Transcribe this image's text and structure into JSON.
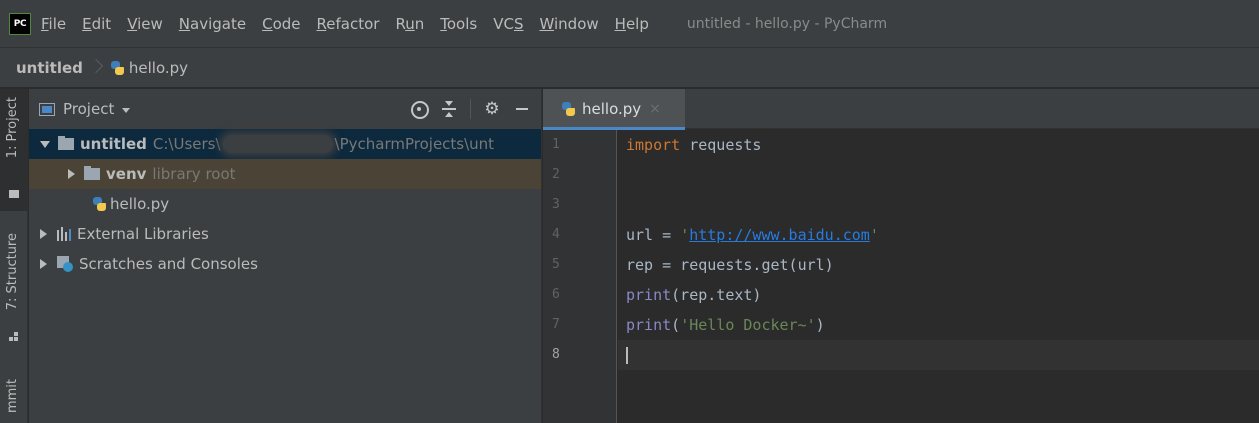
{
  "app": {
    "logo_text": "PC",
    "window_title": "untitled - hello.py - PyCharm"
  },
  "menu": [
    {
      "pre": "",
      "key": "F",
      "post": "ile"
    },
    {
      "pre": "",
      "key": "E",
      "post": "dit"
    },
    {
      "pre": "",
      "key": "V",
      "post": "iew"
    },
    {
      "pre": "",
      "key": "N",
      "post": "avigate"
    },
    {
      "pre": "",
      "key": "C",
      "post": "ode"
    },
    {
      "pre": "",
      "key": "R",
      "post": "efactor"
    },
    {
      "pre": "R",
      "key": "u",
      "post": "n"
    },
    {
      "pre": "",
      "key": "T",
      "post": "ools"
    },
    {
      "pre": "VC",
      "key": "S",
      "post": ""
    },
    {
      "pre": "",
      "key": "W",
      "post": "indow"
    },
    {
      "pre": "",
      "key": "H",
      "post": "elp"
    }
  ],
  "breadcrumb": {
    "project": "untitled",
    "file": "hello.py"
  },
  "left_stripe": {
    "project_tab": "1: Project",
    "structure_tab": "7: Structure",
    "commit_tab": "mmit"
  },
  "project_panel": {
    "title": "Project",
    "tree": {
      "root_label": "untitled",
      "root_path_start": "C:\\Users\\",
      "root_path_end": "\\PycharmProjects\\unt",
      "venv_label": "venv",
      "venv_hint": "library root",
      "file_label": "hello.py",
      "ext_libs_label": "External Libraries",
      "scratches_label": "Scratches and Consoles"
    }
  },
  "editor": {
    "tab_label": "hello.py",
    "tab_close": "×",
    "line_numbers": [
      "1",
      "2",
      "3",
      "4",
      "5",
      "6",
      "7",
      "8"
    ],
    "current_line": 8,
    "code": {
      "l1_kw": "import",
      "l1_rest": " requests",
      "l4_pre": "url = ",
      "l4_q1": "'",
      "l4_url": "http://www.baidu.com",
      "l4_q2": "'",
      "l5": "rep = requests.get(url)",
      "l6_fn": "print",
      "l6_rest": "(rep.text)",
      "l7_fn": "print",
      "l7_open": "(",
      "l7_str": "'Hello Docker~'",
      "l7_close": ")"
    }
  }
}
